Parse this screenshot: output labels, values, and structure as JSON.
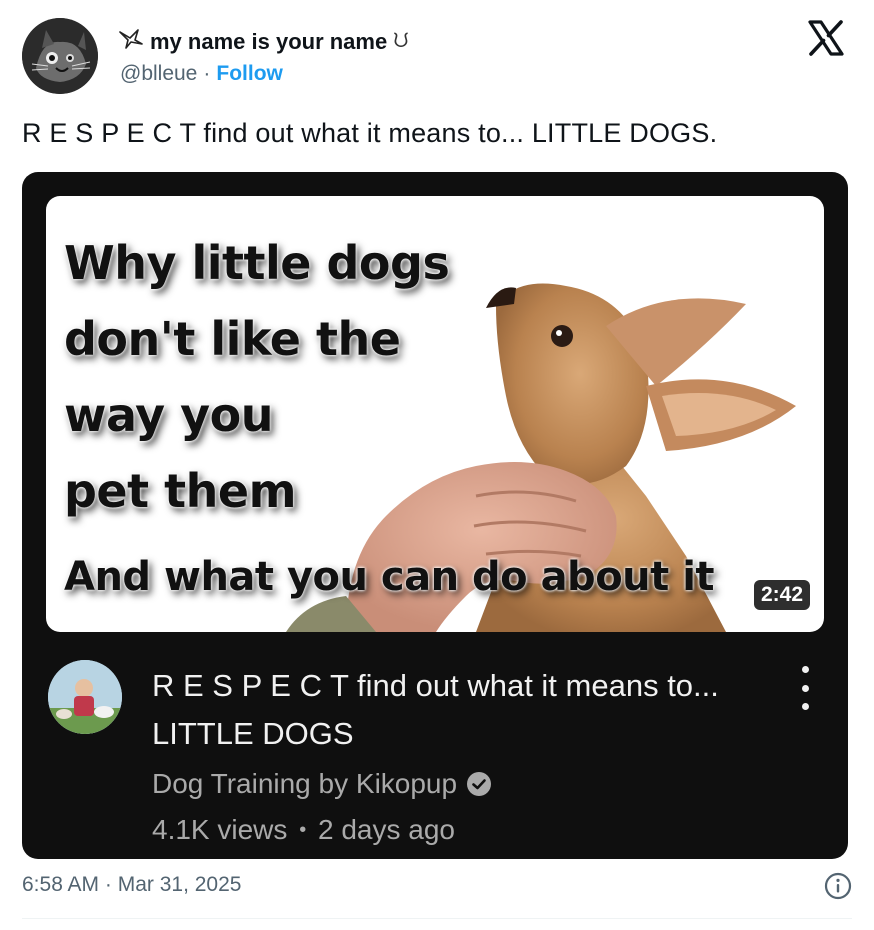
{
  "author": {
    "display_name": "my name is your name",
    "name_decoration": "ᙀ",
    "name_prefix_icon": "bird-icon",
    "handle": "@blleue",
    "separator": "·",
    "follow_label": "Follow"
  },
  "tweet": {
    "text": "R E S P E C T find out what it means to... LITTLE DOGS.",
    "timestamp": "6:58 AM · Mar 31, 2025"
  },
  "video": {
    "thumbnail_lines": [
      "Why little dogs",
      "don't like the",
      "way you",
      "pet them",
      "And what you can do about it"
    ],
    "duration": "2:42",
    "title": "R E S P E C T find out what it means to... LITTLE DOGS",
    "channel": "Dog Training by Kikopup",
    "verified_icon": "check-circle-icon",
    "views": "4.1K views",
    "bullet": "•",
    "age": "2 days ago",
    "menu_icon": "more-vertical-icon"
  },
  "icons": {
    "logo": "x-logo-icon",
    "info": "info-icon"
  },
  "colors": {
    "link": "#1d9bf0",
    "card_bg": "#0f0f0f",
    "muted": "#536471",
    "video_meta": "#aaaaaa"
  }
}
